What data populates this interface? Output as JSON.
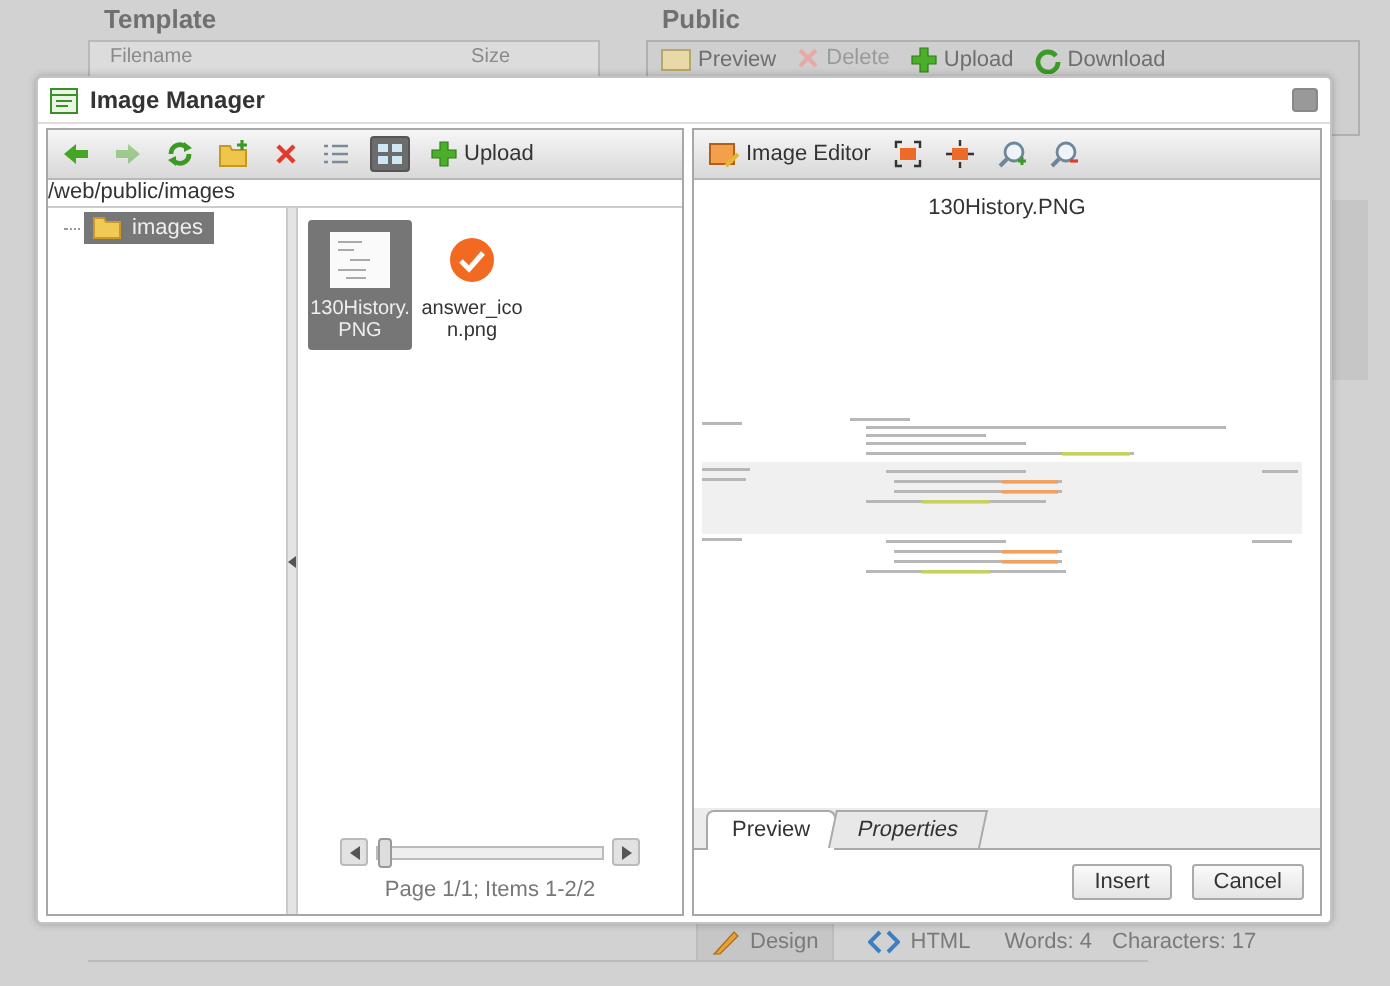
{
  "background_page": {
    "template_heading": "Template",
    "template_columns": [
      "Filename",
      "Size"
    ],
    "public_heading": "Public",
    "public_toolbar": [
      {
        "kind": "preview",
        "label": "Preview",
        "disabled": false
      },
      {
        "kind": "delete",
        "label": "Delete",
        "disabled": true
      },
      {
        "kind": "upload",
        "label": "Upload",
        "disabled": false
      },
      {
        "kind": "download",
        "label": "Download",
        "disabled": false
      }
    ],
    "editor_modes": [
      {
        "kind": "design",
        "label": "Design",
        "selected": true
      },
      {
        "kind": "html",
        "label": "HTML",
        "selected": false
      }
    ],
    "word_count": "Words: 4",
    "character_count": "Characters: 17"
  },
  "dialog": {
    "title": "Image Manager",
    "toolbar": [
      {
        "kind": "back",
        "disabled": false,
        "selected": false
      },
      {
        "kind": "forward",
        "disabled": true,
        "selected": false
      },
      {
        "kind": "refresh",
        "disabled": false,
        "selected": false
      },
      {
        "kind": "new-folder",
        "disabled": false,
        "selected": false
      },
      {
        "kind": "delete",
        "disabled": false,
        "selected": false
      },
      {
        "kind": "list-view",
        "disabled": false,
        "selected": false
      },
      {
        "kind": "thumbnail-view",
        "disabled": false,
        "selected": true
      },
      {
        "kind": "upload",
        "label": "Upload",
        "disabled": false,
        "selected": false
      }
    ],
    "path": "/web/public/images",
    "tree": [
      {
        "label": "images",
        "selected": true
      }
    ],
    "files": [
      {
        "kind": "image",
        "name": "130History.PNG",
        "selected": true
      },
      {
        "kind": "check",
        "name": "answer_icon.png",
        "selected": false
      }
    ],
    "pager": {
      "level": 0,
      "text": "Page 1/1; Items 1-2/2"
    },
    "preview_toolbar": [
      {
        "kind": "image-editor",
        "label": "Image Editor"
      },
      {
        "kind": "fit"
      },
      {
        "kind": "actual-size"
      },
      {
        "kind": "zoom-in"
      },
      {
        "kind": "zoom-out"
      }
    ],
    "preview_filename": "130History.PNG",
    "tabs": [
      {
        "label": "Preview",
        "selected": true
      },
      {
        "label": "Properties",
        "selected": false
      }
    ],
    "buttons": [
      "Insert",
      "Cancel"
    ]
  }
}
